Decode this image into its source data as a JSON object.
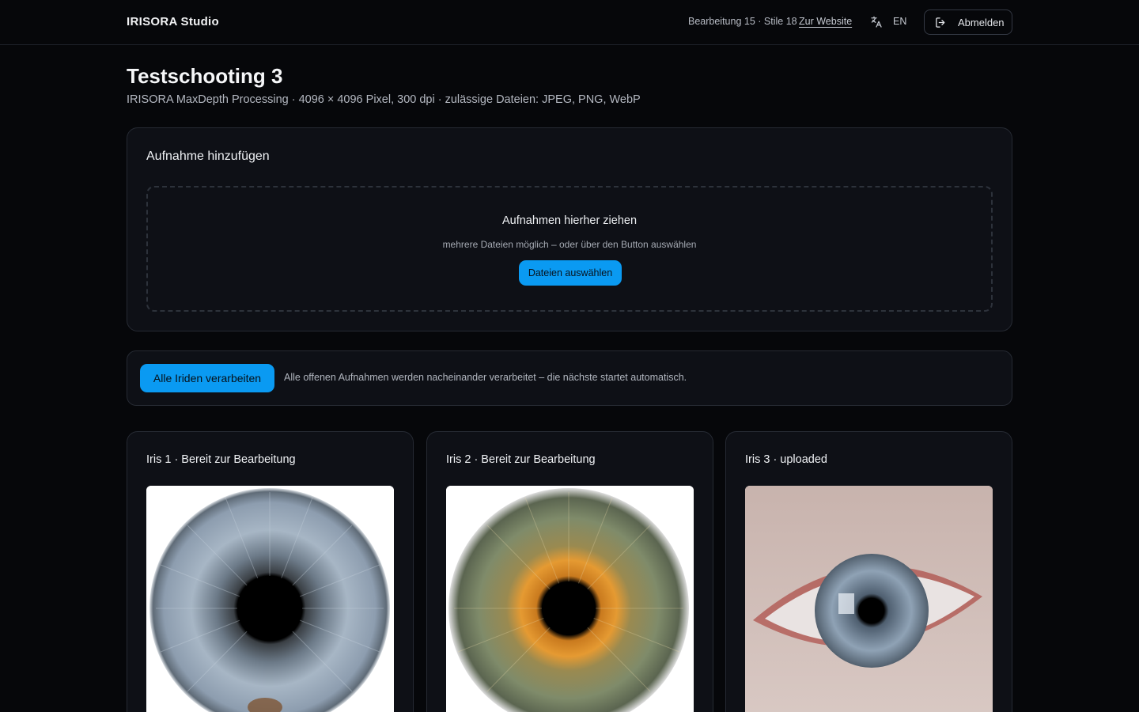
{
  "header": {
    "brand": "IRISORA Studio",
    "counts": "Bearbeitung 15 · Stile 18",
    "website_link": "Zur Website",
    "language": "EN",
    "logout": "Abmelden",
    "icons": [
      "translate-icon",
      "logout-icon"
    ]
  },
  "page": {
    "title": "Testschooting 3",
    "subtitle": "IRISORA MaxDepth Processing · 4096 × 4096 Pixel, 300 dpi · zulässige Dateien: JPEG, PNG, WebP"
  },
  "upload": {
    "heading": "Aufnahme hinzufügen",
    "drop_title": "Aufnahmen hierher ziehen",
    "drop_hint": "mehrere Dateien möglich – oder über den Button auswählen",
    "choose_button": "Dateien auswählen"
  },
  "processing": {
    "button": "Alle Iriden verarbeiten",
    "hint": "Alle offenen Aufnahmen werden nacheinander verarbeitet – die nächste startet automatisch."
  },
  "irises": [
    {
      "title": "Iris 1 · Bereit zur Bearbeitung",
      "image": "blue-grey iris close-up"
    },
    {
      "title": "Iris 2 · Bereit zur Bearbeitung",
      "image": "green-amber iris close-up"
    },
    {
      "title": "Iris 3 · uploaded",
      "image": "eye photograph with blue iris"
    }
  ],
  "colors": {
    "background": "#06070a",
    "card": "#0e1016",
    "border": "#262a33",
    "accent": "#0a9af2"
  }
}
